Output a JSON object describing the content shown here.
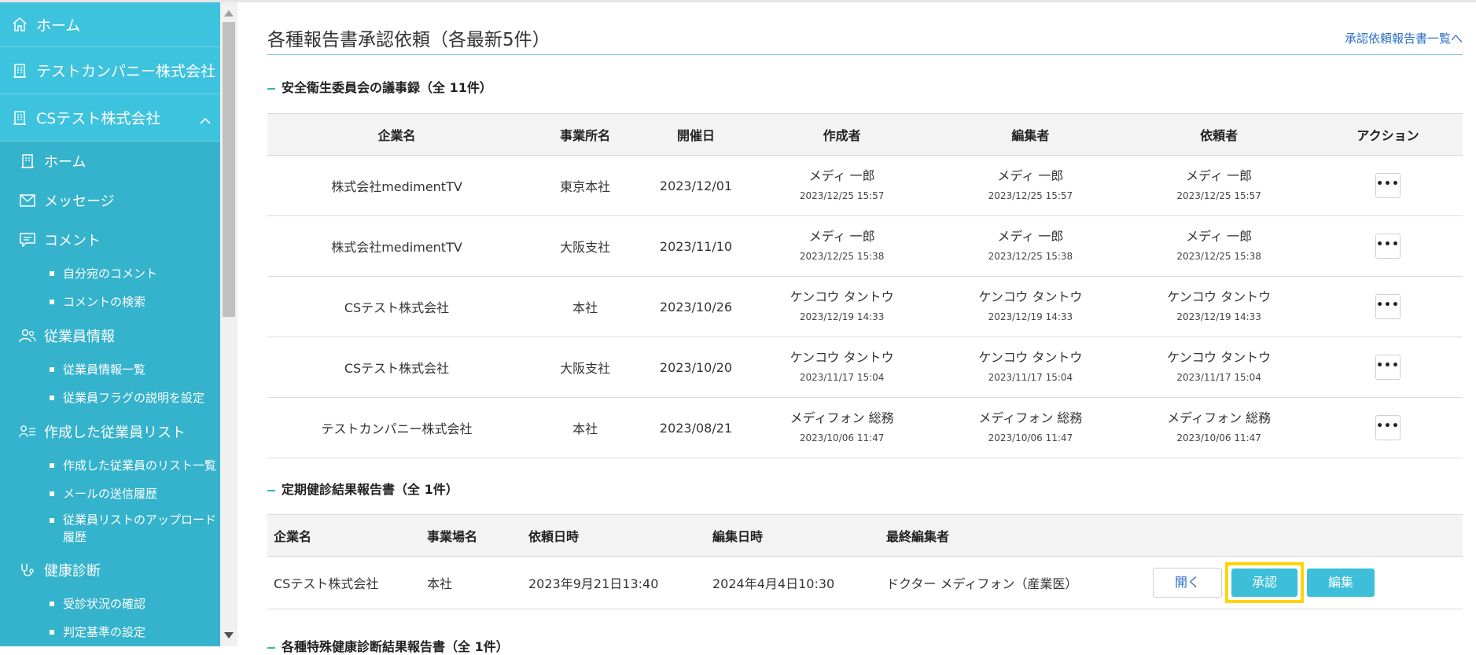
{
  "sidebar": {
    "top": [
      {
        "label": "ホーム",
        "icon": "home-icon"
      },
      {
        "label": "テストカンパニー株式会社",
        "icon": "building-icon"
      },
      {
        "label": "CSテスト株式会社",
        "icon": "building-icon"
      }
    ],
    "items": {
      "home": "ホーム",
      "message": "メッセージ",
      "comment": "コメント",
      "comment_sub1": "自分宛のコメント",
      "comment_sub2": "コメントの検索",
      "employee": "従業員情報",
      "employee_sub1": "従業員情報一覧",
      "employee_sub2": "従業員フラグの説明を設定",
      "created_list": "作成した従業員リスト",
      "created_sub1": "作成した従業員のリスト一覧",
      "created_sub2": "メールの送信履歴",
      "created_sub3": "従業員リストのアップロード履歴",
      "checkup": "健康診断",
      "checkup_sub1": "受診状況の確認",
      "checkup_sub2": "判定基準の設定"
    }
  },
  "main": {
    "title": "各種報告書承認依頼（各最新5件）",
    "link": "承認依頼報告書一覧へ",
    "section1": {
      "heading": "安全衛生委員会の議事録（全 11件）",
      "columns": [
        "企業名",
        "事業所名",
        "開催日",
        "作成者",
        "編集者",
        "依頼者",
        "アクション"
      ],
      "action_label": "•••",
      "rows": [
        {
          "company": "株式会社medimentTV",
          "office": "東京本社",
          "date": "2023/12/01",
          "creator": "メディ 一郎",
          "creator_ts": "2023/12/25 15:57",
          "editor": "メディ 一郎",
          "editor_ts": "2023/12/25 15:57",
          "requester": "メディ 一郎",
          "requester_ts": "2023/12/25 15:57"
        },
        {
          "company": "株式会社medimentTV",
          "office": "大阪支社",
          "date": "2023/11/10",
          "creator": "メディ 一郎",
          "creator_ts": "2023/12/25 15:38",
          "editor": "メディ 一郎",
          "editor_ts": "2023/12/25 15:38",
          "requester": "メディ 一郎",
          "requester_ts": "2023/12/25 15:38"
        },
        {
          "company": "CSテスト株式会社",
          "office": "本社",
          "date": "2023/10/26",
          "creator": "ケンコウ タントウ",
          "creator_ts": "2023/12/19 14:33",
          "editor": "ケンコウ タントウ",
          "editor_ts": "2023/12/19 14:33",
          "requester": "ケンコウ タントウ",
          "requester_ts": "2023/12/19 14:33"
        },
        {
          "company": "CSテスト株式会社",
          "office": "大阪支社",
          "date": "2023/10/20",
          "creator": "ケンコウ タントウ",
          "creator_ts": "2023/11/17 15:04",
          "editor": "ケンコウ タントウ",
          "editor_ts": "2023/11/17 15:04",
          "requester": "ケンコウ タントウ",
          "requester_ts": "2023/11/17 15:04"
        },
        {
          "company": "テストカンパニー株式会社",
          "office": "本社",
          "date": "2023/08/21",
          "creator": "メディフォン 総務",
          "creator_ts": "2023/10/06 11:47",
          "editor": "メディフォン 総務",
          "editor_ts": "2023/10/06 11:47",
          "requester": "メディフォン 総務",
          "requester_ts": "2023/10/06 11:47"
        }
      ]
    },
    "section2": {
      "heading": "定期健診結果報告書（全 1件）",
      "columns": [
        "企業名",
        "事業場名",
        "依頼日時",
        "編集日時",
        "最終編集者"
      ],
      "row": {
        "company": "CSテスト株式会社",
        "office": "本社",
        "requested": "2023年9月21日13:40",
        "edited": "2024年4月4日10:30",
        "editor": "ドクター メディフォン（産業医）"
      },
      "buttons": {
        "open": "開く",
        "approve": "承認",
        "edit": "編集"
      }
    },
    "section3": {
      "heading": "各種特殊健康診断結果報告書（全 1件）"
    }
  },
  "colors": {
    "sidebar": "#35b3cc",
    "sidebar_top": "#3dc3dd",
    "accent": "#3dbfd9",
    "link": "#2a6fc9",
    "highlight": "#ffd400"
  }
}
